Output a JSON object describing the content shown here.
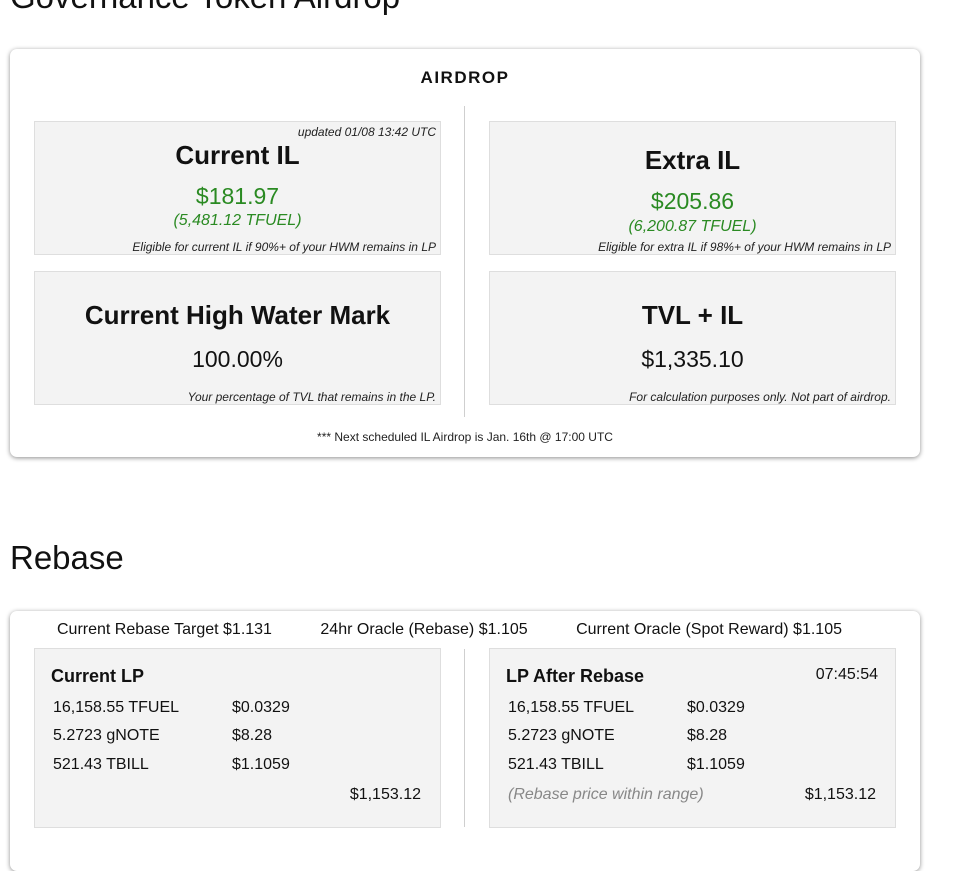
{
  "airdrop_section": {
    "title": "Governance Token Airdrop",
    "header": "AIRDROP",
    "current_il": {
      "updated": "updated 01/08 13:42 UTC",
      "title": "Current IL",
      "usd": "$181.97",
      "tfuel": "(5,481.12 TFUEL)",
      "note": "Eligible for current IL if 90%+ of your HWM remains in LP"
    },
    "extra_il": {
      "title": "Extra IL",
      "usd": "$205.86",
      "tfuel": "(6,200.87 TFUEL)",
      "note": "Eligible for extra IL if 98%+ of your HWM remains in LP"
    },
    "high_water_mark": {
      "title": "Current High Water Mark",
      "value": "100.00%",
      "note": "Your percentage of TVL that remains in the LP."
    },
    "tvl_il": {
      "title": "TVL + IL",
      "value": "$1,335.10",
      "note": "For calculation purposes only. Not part of airdrop."
    },
    "footnote": "*** Next scheduled IL Airdrop is Jan. 16th @ 17:00 UTC"
  },
  "rebase_section": {
    "title": "Rebase",
    "oracles": [
      "Current Rebase Target $1.131",
      "24hr Oracle (Rebase) $1.105",
      "Current Oracle (Spot Reward) $1.105"
    ],
    "current_lp": {
      "title": "Current LP",
      "rows": [
        {
          "amount": "16,158.55 TFUEL",
          "price": "$0.0329"
        },
        {
          "amount": "5.2723 gNOTE",
          "price": "$8.28"
        },
        {
          "amount": "521.43 TBILL",
          "price": "$1.1059"
        }
      ],
      "total": "$1,153.12"
    },
    "lp_after_rebase": {
      "title": "LP After Rebase",
      "time": "07:45:54",
      "rows": [
        {
          "amount": "16,158.55 TFUEL",
          "price": "$0.0329"
        },
        {
          "amount": "5.2723 gNOTE",
          "price": "$8.28"
        },
        {
          "amount": "521.43 TBILL",
          "price": "$1.1059"
        }
      ],
      "range_note": "(Rebase price within range)",
      "total": "$1,153.12"
    }
  }
}
